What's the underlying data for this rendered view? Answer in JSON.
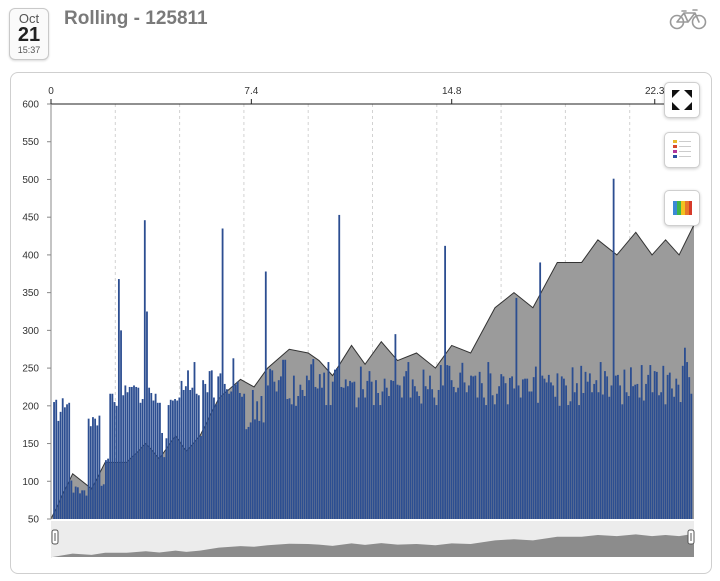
{
  "header": {
    "date_month": "Oct",
    "date_day": "21",
    "date_time": "15:37",
    "title": "Rolling - 125811",
    "activity_icon": "bicycle-icon"
  },
  "toolbar": {
    "buttons": [
      {
        "icon": "fullscreen-icon"
      },
      {
        "icon": "legend-list-icon"
      },
      {
        "icon": "color-palette-icon"
      }
    ]
  },
  "colors": {
    "bar": "#2c4e91",
    "area": "#9b9b9b",
    "area_line": "#333333",
    "overview": "#8c8c8c"
  },
  "chart_data": {
    "type": "bar",
    "ylim": [
      50,
      600
    ],
    "y_ticks": [
      50,
      100,
      150,
      200,
      250,
      300,
      350,
      400,
      450,
      500,
      550,
      600
    ],
    "x_ticks": [
      "0",
      "7.4",
      "14.8",
      "22.3"
    ],
    "x_tick_values": [
      0,
      7.4,
      14.8,
      22.3
    ],
    "xlim": [
      0,
      23.75
    ],
    "grid": "vertical-dashed",
    "series": [
      {
        "type": "area",
        "x": [
          0,
          0.8,
          1.5,
          2.0,
          2.8,
          3.5,
          4.0,
          4.6,
          5.0,
          5.5,
          6.2,
          7.0,
          7.5,
          8.0,
          8.8,
          9.5,
          9.9,
          10.4,
          11.1,
          11.6,
          12.2,
          12.8,
          13.5,
          14.2,
          14.8,
          15.5,
          16.4,
          17.1,
          17.8,
          18.7,
          19.6,
          20.2,
          20.9,
          21.6,
          22.2,
          22.7,
          23.2,
          23.75
        ],
        "values": [
          50,
          110,
          90,
          125,
          125,
          150,
          130,
          160,
          140,
          160,
          210,
          235,
          225,
          250,
          275,
          270,
          260,
          240,
          280,
          255,
          285,
          260,
          270,
          250,
          280,
          270,
          330,
          350,
          330,
          390,
          390,
          420,
          400,
          430,
          400,
          420,
          400,
          440
        ]
      },
      {
        "type": "bar",
        "x_start": 0,
        "x_end": 23.7,
        "values": [
          50,
          205,
          208,
          180,
          192,
          210,
          198,
          202,
          204,
          101,
          85,
          93,
          92,
          84,
          88,
          88,
          81,
          183,
          173,
          185,
          183,
          174,
          187,
          94,
          96,
          128,
          130,
          216,
          216,
          205,
          200,
          368,
          300,
          214,
          227,
          218,
          225,
          225,
          227,
          225,
          224,
          204,
          209,
          446,
          325,
          224,
          217,
          207,
          216,
          204,
          204,
          164,
          132,
          157,
          201,
          208,
          207,
          209,
          207,
          211,
          233,
          221,
          226,
          247,
          221,
          224,
          258,
          216,
          214,
          160,
          234,
          229,
          218,
          246,
          247,
          211,
          202,
          239,
          243,
          234,
          229,
          222,
          216,
          219,
          263,
          228,
          232,
          217,
          212,
          216,
          169,
          172,
          178,
          221,
          182,
          206,
          180,
          213,
          178,
          236,
          227,
          249,
          247,
          232,
          219,
          234,
          239,
          261,
          261,
          209,
          210,
          202,
          240,
          200,
          213,
          228,
          221,
          213,
          240,
          234,
          249,
          262,
          225,
          223,
          242,
          224,
          244,
          201,
          258,
          201,
          232,
          248,
          250,
          229,
          225,
          224,
          235,
          226,
          233,
          231,
          232,
          198,
          211,
          252,
          222,
          211,
          233,
          246,
          232,
          201,
          234,
          217,
          201,
          219,
          236,
          224,
          213,
          234,
          233,
          214,
          228,
          227,
          211,
          239,
          246,
          258,
          211,
          235,
          226,
          219,
          213,
          203,
          248,
          226,
          222,
          240,
          222,
          211,
          201,
          221,
          254,
          227,
          253,
          254,
          253,
          234,
          225,
          218,
          224,
          244,
          232,
          231,
          218,
          227,
          240,
          239,
          240,
          211,
          245,
          230,
          211,
          201,
          258,
          243,
          214,
          202,
          216,
          226,
          242,
          239,
          230,
          202,
          237,
          239,
          223,
          232,
          227,
          211,
          235,
          236,
          236,
          219,
          219,
          238,
          252,
          204,
          243,
          240,
          236,
          231,
          241,
          231,
          227,
          212,
          243,
          200,
          239,
          236,
          227,
          201,
          206,
          251,
          218,
          230,
          201,
          253,
          217,
          245,
          232,
          243,
          218,
          229,
          234,
          218,
          224,
          215,
          246,
          239,
          212,
          227,
          246,
          240,
          241,
          227,
          202,
          248,
          218,
          213,
          251,
          226,
          228,
          229,
          211,
          254,
          207,
          229,
          241,
          254,
          218,
          246,
          245,
          214,
          218,
          253,
          202,
          241,
          244,
          223,
          212,
          236,
          228,
          205,
          253,
          277,
          258,
          238,
          216
        ],
        "spikes": [
          [
            260,
            501
          ],
          [
            99,
            378
          ],
          [
            133,
            453
          ],
          [
            159,
            295
          ],
          [
            182,
            412
          ],
          [
            215,
            343
          ],
          [
            226,
            390
          ],
          [
            120,
            255
          ],
          [
            190,
            257
          ],
          [
            254,
            258
          ],
          [
            79,
            435
          ]
        ]
      }
    ]
  }
}
